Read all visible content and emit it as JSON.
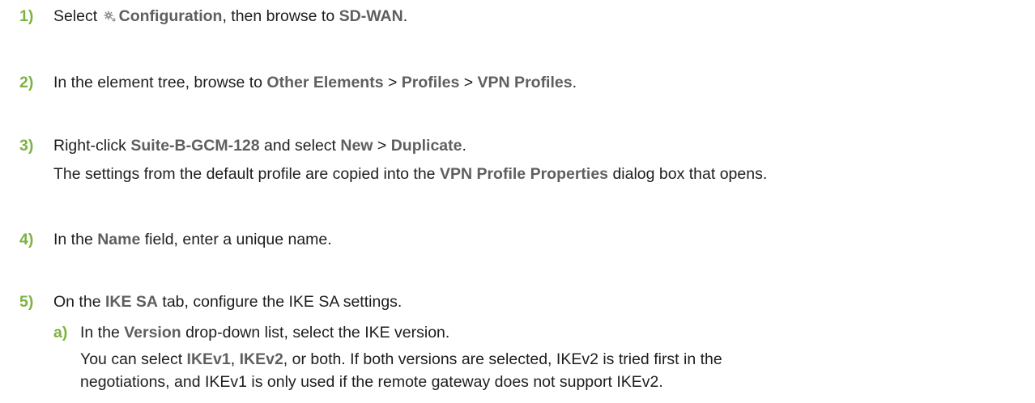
{
  "steps": [
    {
      "number": "1)",
      "parts": {
        "t1": "Select ",
        "icon": "gear-icon",
        "b1": "Configuration",
        "t2": ", then browse to ",
        "b2": "SD-WAN",
        "t3": "."
      }
    },
    {
      "number": "2)",
      "parts": {
        "t1": "In the element tree, browse to ",
        "b1": "Other Elements",
        "t2": " > ",
        "b2": "Profiles",
        "t3": " > ",
        "b3": "VPN Profiles",
        "t4": "."
      }
    },
    {
      "number": "3)",
      "parts": {
        "t1": "Right-click ",
        "b1": "Suite-B-GCM-128",
        "t2": " and select ",
        "b2": "New",
        "t3": " > ",
        "b3": "Duplicate",
        "t4": "."
      },
      "result": {
        "t1": "The settings from the default profile are copied into the ",
        "b1": "VPN Profile Properties",
        "t2": " dialog box that opens."
      }
    },
    {
      "number": "4)",
      "parts": {
        "t1": "In the ",
        "b1": "Name",
        "t2": " field, enter a unique name."
      }
    },
    {
      "number": "5)",
      "parts": {
        "t1": "On the ",
        "b1": "IKE SA",
        "t2": " tab, configure the IKE SA settings."
      },
      "substeps": [
        {
          "number": "a)",
          "parts": {
            "t1": "In the ",
            "b1": "Version",
            "t2": " drop-down list, select the IKE version."
          },
          "result": {
            "t1": "You can select ",
            "b1": "IKEv1",
            "t2": ", ",
            "b2": "IKEv2",
            "t3": ", or both. If both versions are selected, IKEv2 is tried first in the",
            "t4": "negotiations, and IKEv1 is only used if the remote gateway does not support IKEv2."
          }
        }
      ]
    }
  ],
  "colors": {
    "step_number": "#7cb342",
    "ui_term": "#5f5f5f",
    "body_text": "#1e1e1e"
  }
}
